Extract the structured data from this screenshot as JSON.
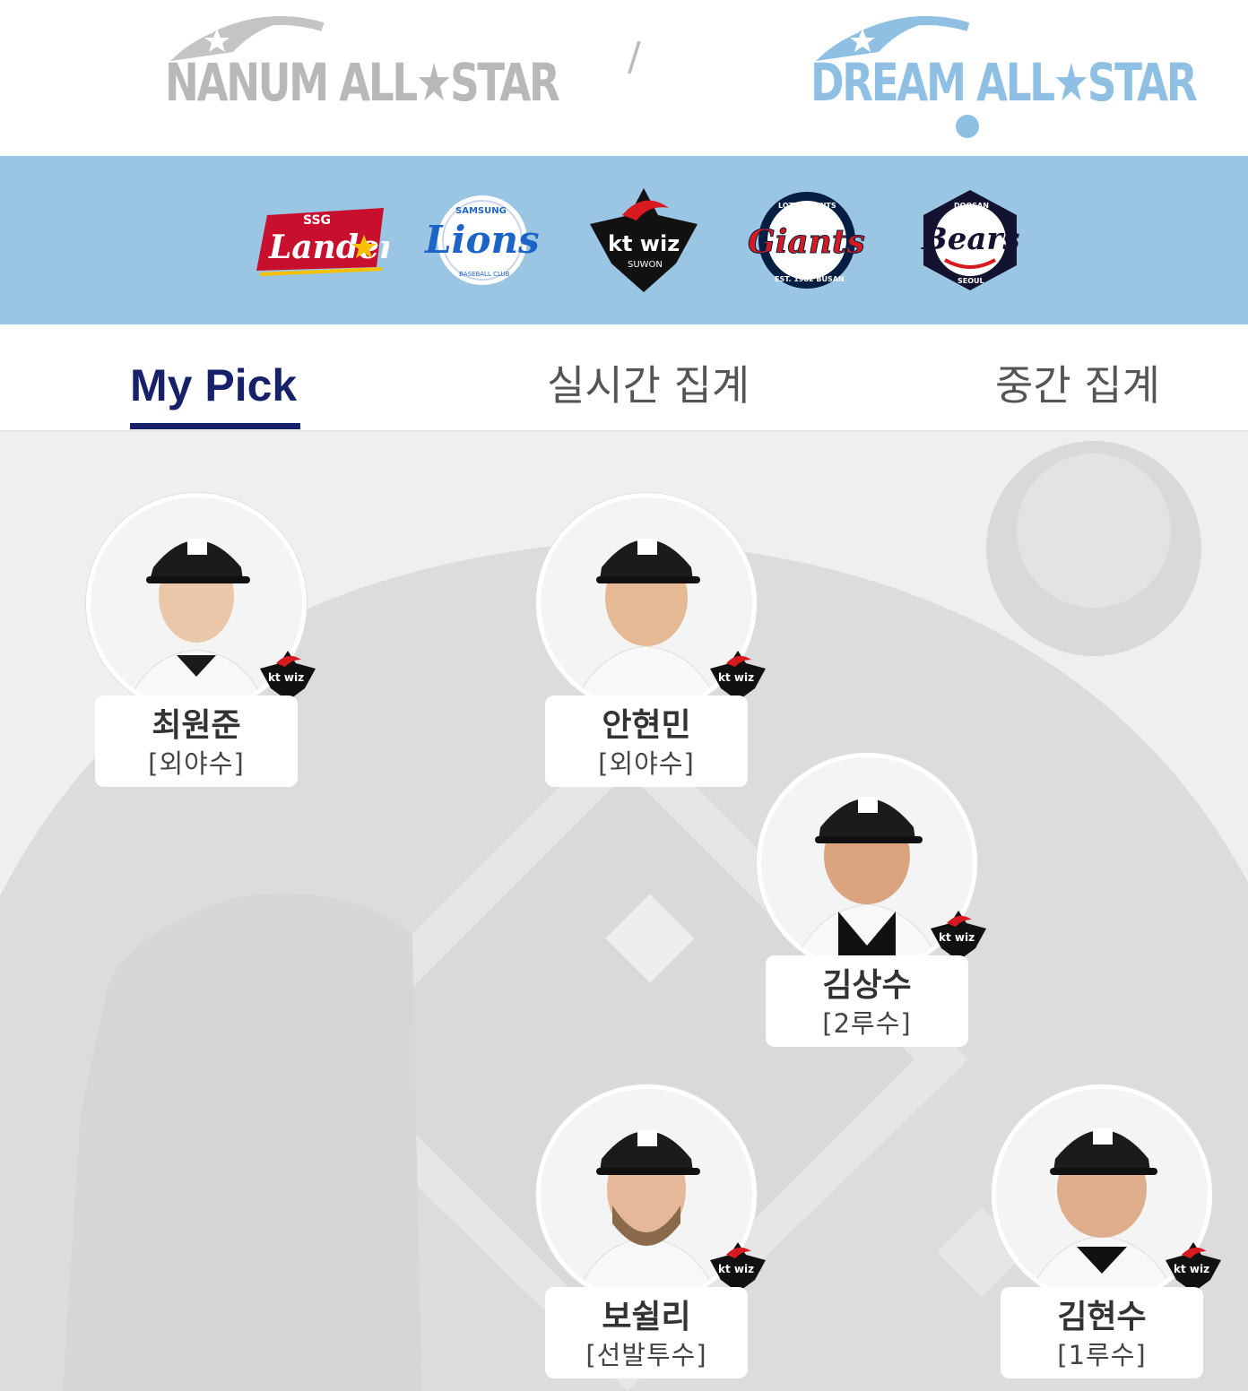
{
  "leagues": {
    "nanum": {
      "label": "NANUM ALL★STAR",
      "active": false,
      "color": "#b8b8b8"
    },
    "separator": "/",
    "dream": {
      "label": "DREAM ALL★STAR",
      "active": true,
      "color": "#8fc0e3"
    }
  },
  "teams": [
    {
      "name": "SSG Landers",
      "logo_text": "Landers",
      "small_text": "SSG",
      "color": "#c8102e"
    },
    {
      "name": "Samsung Lions",
      "logo_text": "Lions",
      "small_text": "SAMSUNG",
      "sub_text": "BASEBALL CLUB",
      "color": "#1d64c8"
    },
    {
      "name": "kt wiz",
      "logo_text": "kt wiz",
      "small_text": "SUWON",
      "color": "#111111"
    },
    {
      "name": "Lotte Giants",
      "logo_text": "Giants",
      "small_text": "LOTTE GIANTS",
      "sub_text": "EST. 1982 BUSAN",
      "color": "#041e42"
    },
    {
      "name": "Doosan Bears",
      "logo_text": "Bears",
      "small_text": "DOOSAN",
      "sub_text": "SEOUL",
      "color": "#131230"
    }
  ],
  "tabs": [
    {
      "label": "My Pick",
      "active": true
    },
    {
      "label": "실시간 집계",
      "active": false
    },
    {
      "label": "중간 집계",
      "active": false
    }
  ],
  "players": [
    {
      "name": "최원준",
      "position": "[외야수]",
      "team": "kt wiz"
    },
    {
      "name": "안현민",
      "position": "[외야수]",
      "team": "kt wiz"
    },
    {
      "name": "김상수",
      "position": "[2루수]",
      "team": "kt wiz"
    },
    {
      "name": "보쉴리",
      "position": "[선발투수]",
      "team": "kt wiz"
    },
    {
      "name": "김현수",
      "position": "[1루수]",
      "team": "kt wiz"
    }
  ],
  "badge": {
    "text": "kt wiz",
    "sub": "SUWON"
  },
  "colors": {
    "accent": "#16216a",
    "team_strip": "#9ac5e3",
    "field_bg": "#efefef",
    "field_shape": "#dcdcdc"
  }
}
